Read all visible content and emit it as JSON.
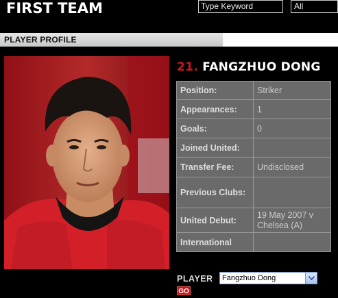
{
  "header": {
    "title": "FIRST TEAM",
    "search_placeholder": "Type Keyword",
    "category": "All"
  },
  "section_label": "PLAYER PROFILE",
  "player": {
    "number": "21.",
    "name": "FANGZHUO DONG"
  },
  "stats": [
    {
      "label": "Position:",
      "value": "Striker"
    },
    {
      "label": "Appearances:",
      "value": "1"
    },
    {
      "label": "Goals:",
      "value": "0"
    },
    {
      "label": "Joined United:",
      "value": ""
    },
    {
      "label": "Transfer Fee:",
      "value": "Undisclosed"
    },
    {
      "label": "Previous Clubs:",
      "value": ""
    },
    {
      "label": "United Debut:",
      "value": "19 May 2007 v Chelsea (A)"
    },
    {
      "label": "International",
      "value": ""
    }
  ],
  "selector": {
    "label": "PLAYER",
    "selected": "Fangzhuo Dong",
    "go": "GO"
  },
  "colors": {
    "accent": "#d0161a",
    "table_bg": "#6a6a6a"
  }
}
